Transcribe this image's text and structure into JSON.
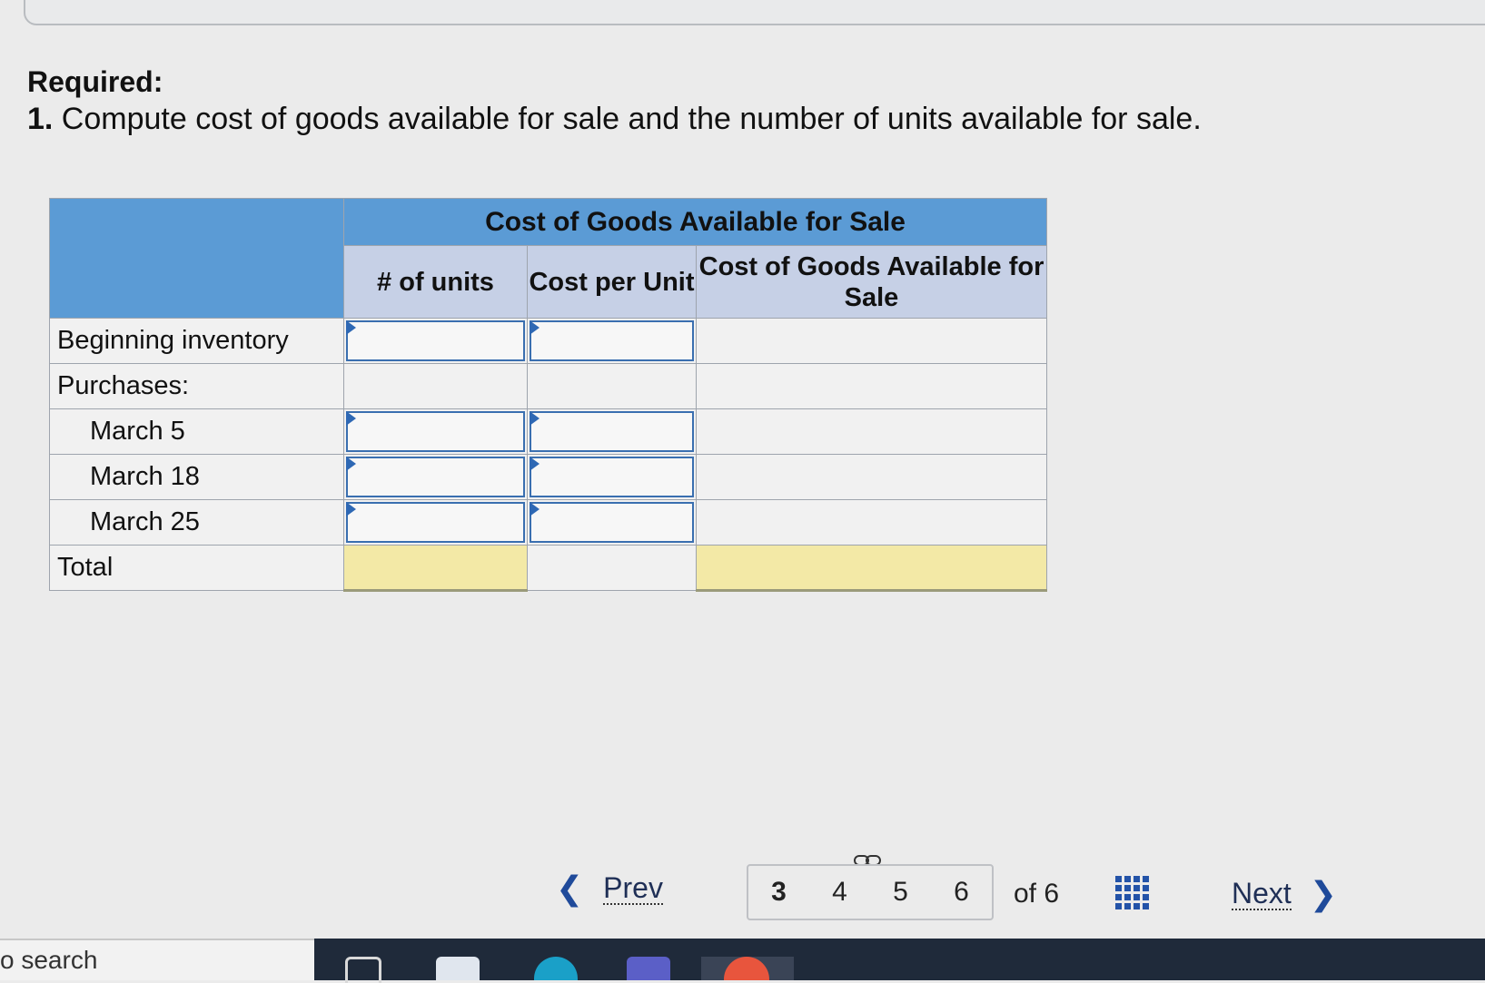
{
  "question": {
    "required_label": "Required:",
    "number": "1.",
    "text": " Compute cost of goods available for sale and the number of units available for sale."
  },
  "table": {
    "group_header": "Cost of Goods Available for Sale",
    "columns": [
      "# of units",
      "Cost per Unit",
      "Cost of Goods Available for Sale"
    ],
    "rows": {
      "beginning": "Beginning inventory",
      "purchases": "Purchases:",
      "march5": "March 5",
      "march18": "March 18",
      "march25": "March 25",
      "total": "Total"
    }
  },
  "pagination": {
    "prev_label": "Prev",
    "next_label": "Next",
    "pages": [
      "3",
      "4",
      "5",
      "6"
    ],
    "current": "3",
    "of_label": "of 6"
  },
  "taskbar": {
    "search_text": "o search"
  },
  "icons": {
    "prev": "chevron-left-icon",
    "next": "chevron-right-icon",
    "link": "link-icon",
    "grid": "grid-icon"
  },
  "colors": {
    "header_blue": "#5b9bd5",
    "subheader": "#c6d0e6",
    "total_fill": "#f3e9a6",
    "input_border": "#3a6fb0"
  }
}
